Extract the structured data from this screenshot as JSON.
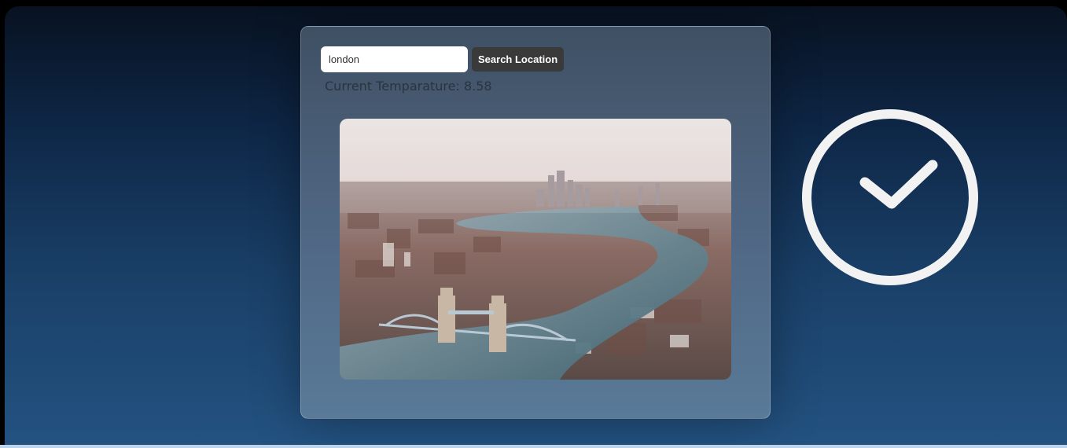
{
  "search": {
    "value": "london",
    "button_label": "Search Location"
  },
  "weather": {
    "temperature_text": "Current Temparature: 8.58"
  },
  "photo": {
    "subject": "aerial-city-river-view"
  },
  "status_icon": {
    "name": "check-circle-icon"
  },
  "colors": {
    "accent": "#3a3a3a",
    "background_top": "#081221",
    "background_bottom": "#235281"
  }
}
